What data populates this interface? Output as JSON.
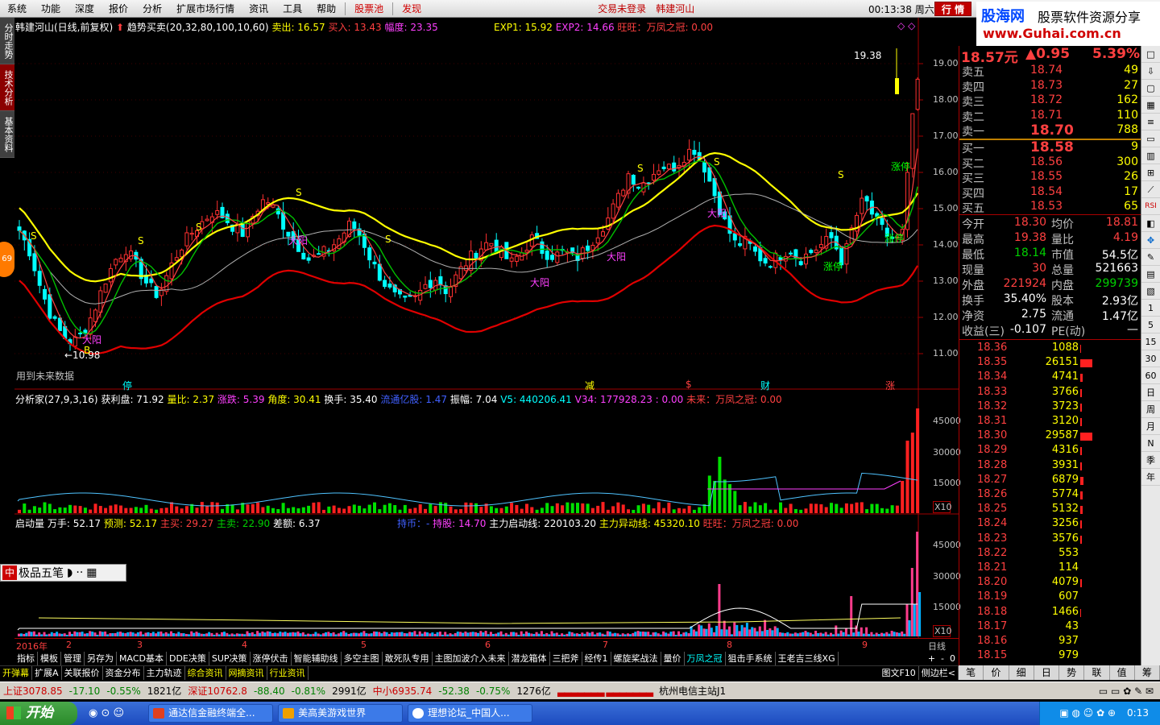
{
  "menu": {
    "items": [
      "系统",
      "功能",
      "深度",
      "报价",
      "分析",
      "扩展市场行情",
      "资讯",
      "工具",
      "帮助"
    ],
    "red_items": [
      "股票池",
      "发现"
    ],
    "login_status": "交易未登录",
    "stock_name": "韩建河山",
    "clock": "00:13:38 周六",
    "hangqing": "行 情"
  },
  "logo": {
    "title": "股海网",
    "subtitle": "股票软件资源分享",
    "url": "www.Guhai.com.cn"
  },
  "left_tabs": [
    "分时走势",
    "技术分析",
    "基本资料"
  ],
  "orb_value": "69",
  "main_header": {
    "name": "韩建河山(日线,前复权)",
    "indicator": "趋势买卖(20,32,80,100,10,60)",
    "sell": "卖出: 16.57",
    "buy": "买入: 13.43",
    "range": "幅度: 23.35",
    "exp1": "EXP1: 15.92",
    "exp2": "EXP2: 14.66",
    "wangwang": "旺旺：万凤之冠: 0.00"
  },
  "price_axis": [
    "19.00",
    "18.00",
    "17.00",
    "16.00",
    "15.00",
    "14.00",
    "13.00",
    "12.00",
    "11.00"
  ],
  "chart_labels": {
    "high_mark": "19.38",
    "low_mark": "←10.98",
    "future": "用到未来数据",
    "dayang": "大阳",
    "zhangting": "涨停",
    "s": "S",
    "b": "B",
    "events": [
      "停",
      "减",
      "$",
      "财",
      "涨"
    ]
  },
  "panel2_header": {
    "name": "分析家(27,9,3,16)",
    "profit": "获利盘: 71.92",
    "vol_ratio": "量比: 2.37",
    "change": "涨跌: 5.39",
    "angle": "角度: 30.41",
    "turnover": "换手: 35.40",
    "mkt_cap": "流通亿股: 1.47",
    "amplitude": "振幅: 7.04",
    "v5": "V5: 440206.41",
    "v34": "V34: 177928.23 : 0.00",
    "future": "未来：万凤之冠: 0.00"
  },
  "panel2_axis": [
    "45000",
    "30000",
    "15000"
  ],
  "panel3_header": {
    "name": "启动量",
    "wanshou": "万手: 52.17",
    "predict": "预测: 52.17",
    "main_buy": "主买: 29.27",
    "main_sell": "主卖: 22.90",
    "diff": "差额: 6.37",
    "hold": "持币：-",
    "hold_stock": "持股: 14.70",
    "main_start": "主力启动线: 220103.20",
    "main_abn": "主力异动线: 45320.10",
    "ww": "旺旺：万凤之冠: 0.00"
  },
  "panel3_axis": [
    "45000",
    "30000",
    "15000"
  ],
  "x10": "X10",
  "x_axis": [
    "2016年",
    "2",
    "3",
    "4",
    "5",
    "6",
    "7",
    "8",
    "9"
  ],
  "x_period": "日线",
  "tabs_row1": [
    "指标",
    "模板",
    "管理",
    "另存为",
    "MACD基本",
    "DDE决策",
    "SUP决策",
    "涨停伏击",
    "智能辅助线",
    "多空主图",
    "敢死队专用",
    "主图加波介入未来",
    "潜龙箱体",
    "三把斧",
    "经传1",
    "螺旋桨战法",
    "量价",
    "万凤之冠",
    "狙击手系统",
    "王老吉三线XG"
  ],
  "tabs_row2": [
    "开弹幕",
    "扩展A",
    "关联报价",
    "资金分布",
    "主力轨迹",
    "综合资讯",
    "网摘资讯",
    "行业资讯"
  ],
  "tabs_row2_right": [
    "图文F10",
    "侧边栏<"
  ],
  "quote": {
    "price": "18.57元",
    "change": "▲0.95",
    "pct": "5.39%",
    "asks": [
      [
        "卖五",
        "18.74",
        "49"
      ],
      [
        "卖四",
        "18.73",
        "27"
      ],
      [
        "卖三",
        "18.72",
        "162"
      ],
      [
        "卖二",
        "18.71",
        "110"
      ],
      [
        "卖一",
        "18.70",
        "788"
      ]
    ],
    "bids": [
      [
        "买一",
        "18.58",
        "9"
      ],
      [
        "买二",
        "18.56",
        "300"
      ],
      [
        "买三",
        "18.55",
        "26"
      ],
      [
        "买四",
        "18.54",
        "17"
      ],
      [
        "买五",
        "18.53",
        "65"
      ]
    ],
    "stats": [
      [
        "今开",
        "18.30",
        "均价",
        "18.81"
      ],
      [
        "最高",
        "19.38",
        "量比",
        "4.19"
      ],
      [
        "最低",
        "18.14",
        "市值",
        "54.5亿"
      ],
      [
        "现量",
        "30",
        "总量",
        "521663"
      ],
      [
        "外盘",
        "221924",
        "内盘",
        "299739"
      ],
      [
        "换手",
        "35.40%",
        "股本",
        "2.93亿"
      ],
      [
        "净资",
        "2.75",
        "流通",
        "1.47亿"
      ],
      [
        "收益(三)",
        "-0.107",
        "PE(动)",
        "—"
      ]
    ],
    "depth": [
      [
        "18.36",
        "1088",
        0.06
      ],
      [
        "18.35",
        "26151",
        1.0
      ],
      [
        "18.34",
        "4741",
        0.18
      ],
      [
        "18.33",
        "3766",
        0.14
      ],
      [
        "18.32",
        "3723",
        0.14
      ],
      [
        "18.31",
        "3120",
        0.12
      ],
      [
        "18.30",
        "29587",
        1.0
      ],
      [
        "18.29",
        "4316",
        0.16
      ],
      [
        "18.28",
        "3931",
        0.15
      ],
      [
        "18.27",
        "6879",
        0.26
      ],
      [
        "18.26",
        "5774",
        0.22
      ],
      [
        "18.25",
        "5132",
        0.19
      ],
      [
        "18.24",
        "3256",
        0.12
      ],
      [
        "18.23",
        "3576",
        0.13
      ],
      [
        "18.22",
        "553",
        0.02
      ],
      [
        "18.21",
        "114",
        0.0
      ],
      [
        "18.20",
        "4079",
        0.15
      ],
      [
        "18.19",
        "607",
        0.02
      ],
      [
        "18.18",
        "1466",
        0.05
      ],
      [
        "18.17",
        "43",
        0.0
      ],
      [
        "18.16",
        "937",
        0.03
      ],
      [
        "18.15",
        "979",
        0.03
      ]
    ]
  },
  "right_tabs": [
    "笔",
    "价",
    "细",
    "日",
    "势",
    "联",
    "值",
    "筹"
  ],
  "right_toolbar": [
    "1",
    "5",
    "15",
    "30",
    "60",
    "日",
    "周",
    "月",
    "N",
    "季",
    "年"
  ],
  "status": {
    "sh": "上证3078.85",
    "sh_chg": "-17.10",
    "sh_pct": "-0.55%",
    "sh_amt": "1821亿",
    "sz": "深证10762.8",
    "sz_chg": "-88.40",
    "sz_pct": "-0.81%",
    "sz_amt": "2991亿",
    "zx": "中小6935.74",
    "zx_chg": "-52.38",
    "zx_pct": "-0.75%",
    "zx_amt": "1276亿",
    "server": "杭州电信主站J1"
  },
  "ime": {
    "label": "极品五笔"
  },
  "taskbar": {
    "start": "开始",
    "tasks": [
      "通达信金融终端全...",
      "美高美游戏世界",
      "理想论坛_中国人..."
    ],
    "time": "0:13"
  }
}
